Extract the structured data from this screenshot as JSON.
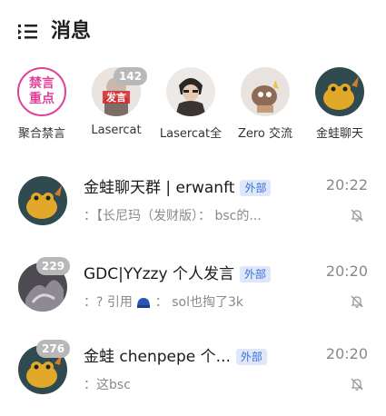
{
  "header": {
    "title": "消息"
  },
  "stories": [
    {
      "label": "聚合禁言",
      "avatar_text": "禁言\n重点",
      "badge": ""
    },
    {
      "label": "Lasercat",
      "avatar_text": "发言",
      "badge": "142"
    },
    {
      "label": "Lasercat全",
      "avatar_text": "",
      "badge": ""
    },
    {
      "label": "Zero 交流",
      "avatar_text": "",
      "badge": ""
    },
    {
      "label": "金蛙聊天",
      "avatar_text": "",
      "badge": ""
    }
  ],
  "chats": [
    {
      "name": "金蛙聊天群 | erwanft",
      "tag": "外部",
      "time": "20:22",
      "preview": "：【长尼玛（发财版）：  bsc的...",
      "badge": ""
    },
    {
      "name": "GDC|YYzzy 个人发言",
      "tag": "外部",
      "time": "20:20",
      "preview": "：?  引用     ：  sol也掏了3k",
      "badge": "229"
    },
    {
      "name": "金蛙 chenpepe 个...",
      "tag": "外部",
      "time": "20:20",
      "preview": "：这bsc",
      "badge": "276"
    }
  ],
  "colors": {
    "accent_pink": "#e0409a",
    "tag_bg": "#dfe8fa",
    "tag_text": "#3b6fd8"
  }
}
